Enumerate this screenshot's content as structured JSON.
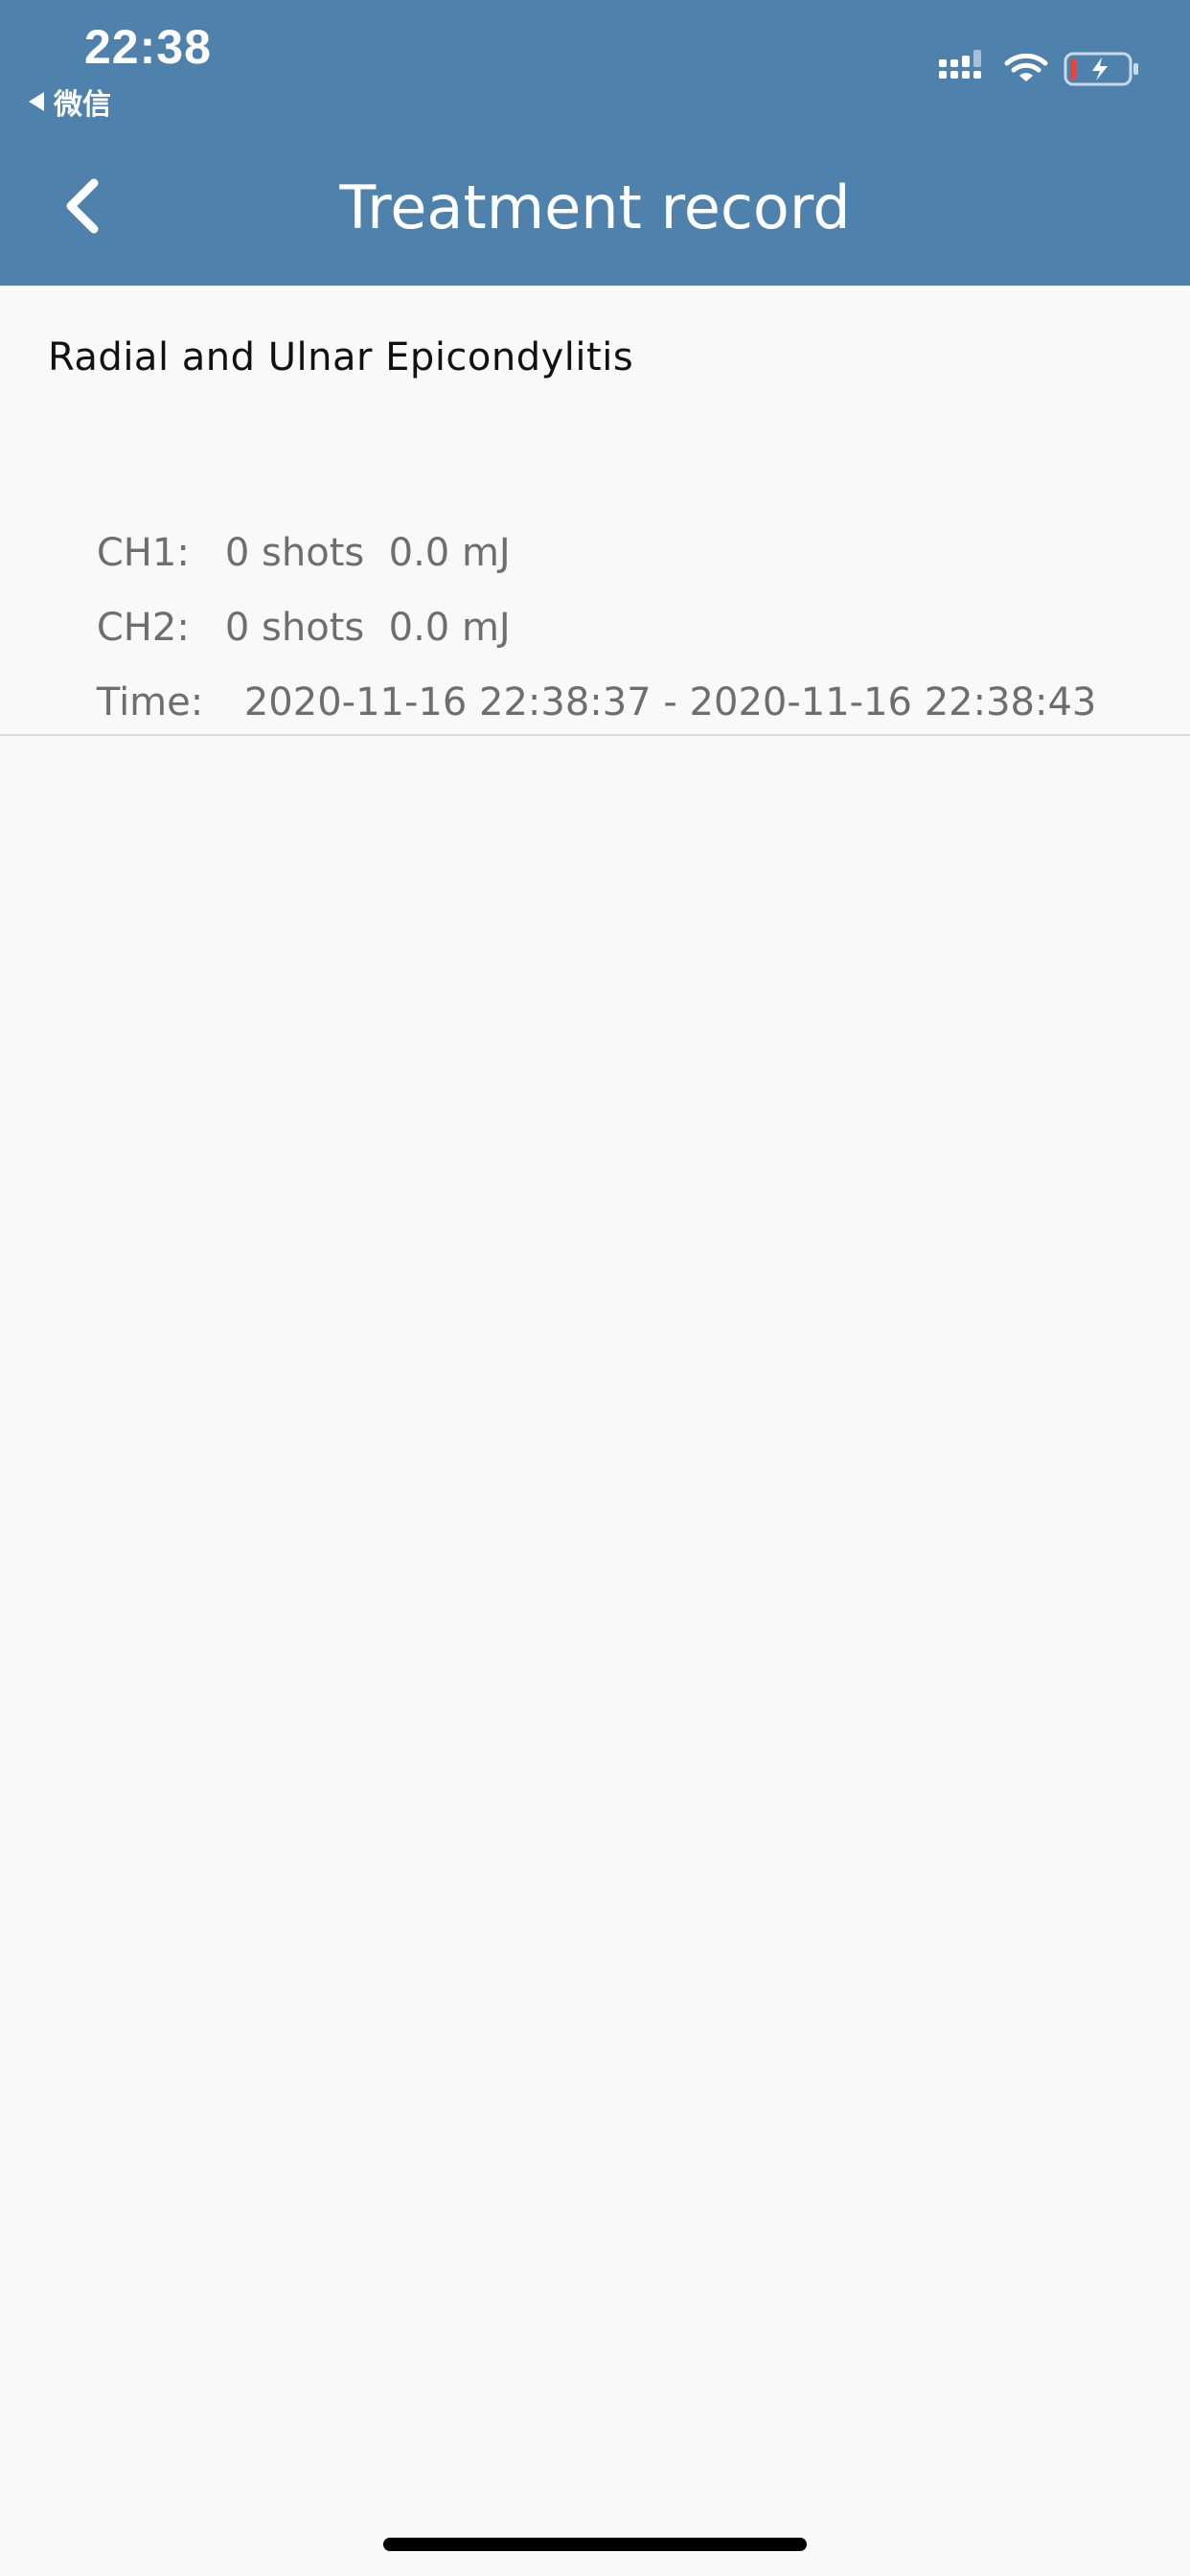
{
  "status_bar": {
    "time": "22:38",
    "back_app_label": "微信",
    "signal_icon": "cellular-signal-icon",
    "wifi_icon": "wifi-icon",
    "battery_icon": "battery-charging-icon",
    "battery_level": 0.1,
    "battery_low_color": "#e8433a"
  },
  "header": {
    "title": "Treatment record",
    "back_icon": "chevron-left-icon",
    "background_color": "#4f81ad"
  },
  "record": {
    "title": "Radial and Ulnar Epicondylitis",
    "ch1": {
      "label": "CH1:",
      "value": "0 shots  0.0 mJ"
    },
    "ch2": {
      "label": "CH2:",
      "value": "0 shots  0.0 mJ"
    },
    "time": {
      "label": "Time:",
      "value": "2020-11-16 22:38:37 - 2020-11-16 22:38:43"
    }
  }
}
